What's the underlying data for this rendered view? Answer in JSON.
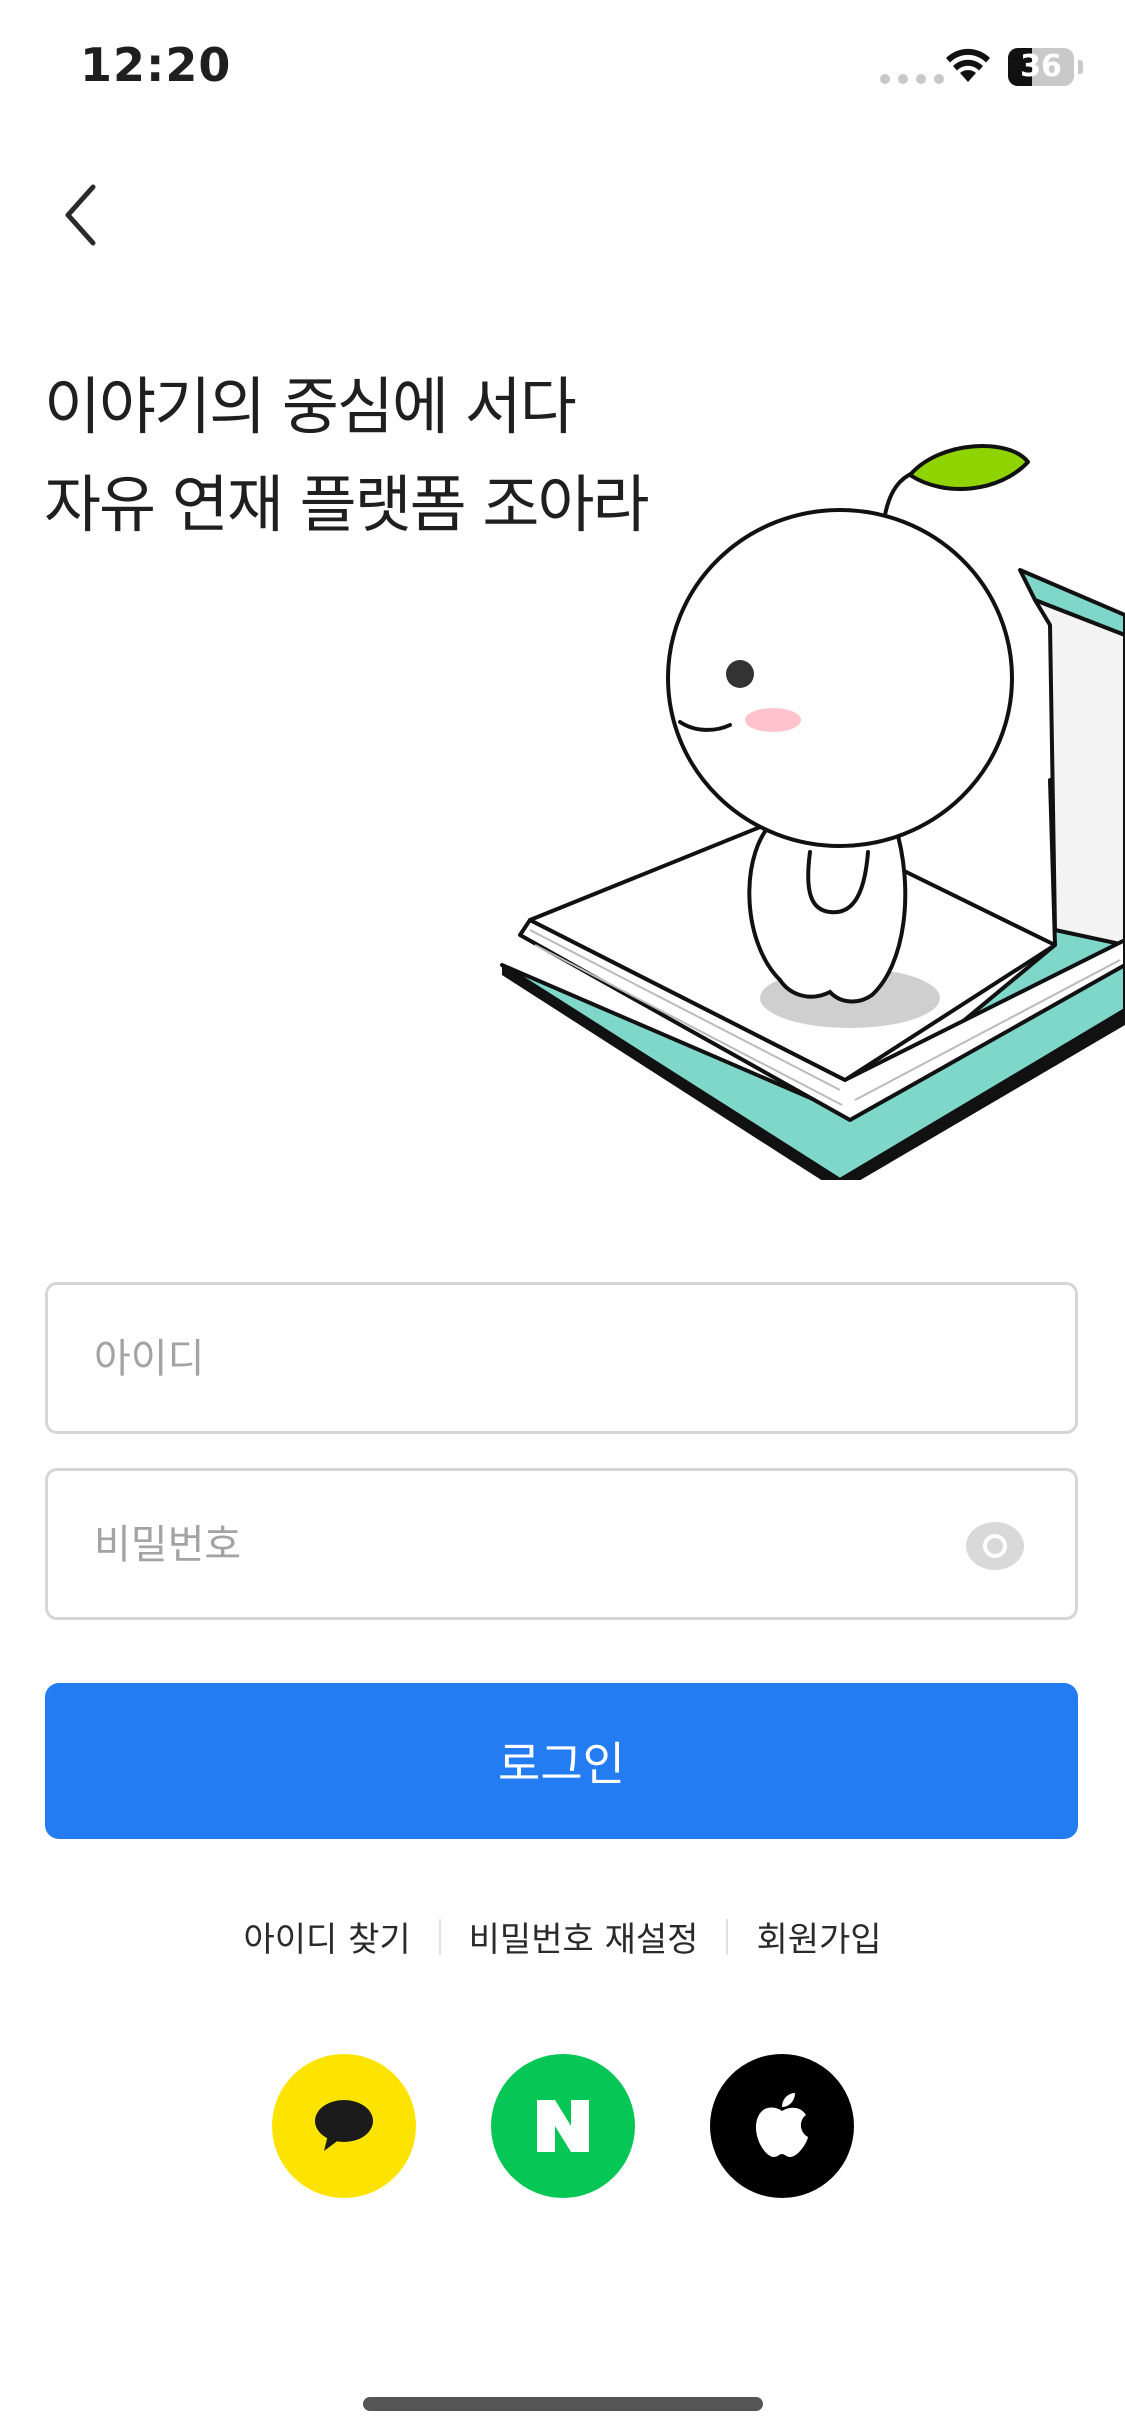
{
  "status_bar": {
    "time": "12:20",
    "battery": "36",
    "battery_level": 0.36
  },
  "header": {
    "back_icon": "chevron-left-icon"
  },
  "headline": {
    "line1": "이야기의 중심에 서다",
    "line2": "자유 연재 플랫폼 조아라"
  },
  "form": {
    "id_placeholder": "아이디",
    "password_placeholder": "비밀번호",
    "show_password_icon": "eye-icon",
    "login_label": "로그인"
  },
  "links": {
    "find_id": "아이디 찾기",
    "reset_password": "비밀번호 재설정",
    "sign_up": "회원가입"
  },
  "social": {
    "kakao_icon": "speech-bubble-icon",
    "naver_label": "N",
    "apple_icon": "apple-icon"
  },
  "colors": {
    "accent": "#237cf2",
    "kakao": "#fde400",
    "naver": "#06c755",
    "apple": "#000000",
    "leaf": "#8fd400",
    "book_cover": "#7fd7c9"
  }
}
